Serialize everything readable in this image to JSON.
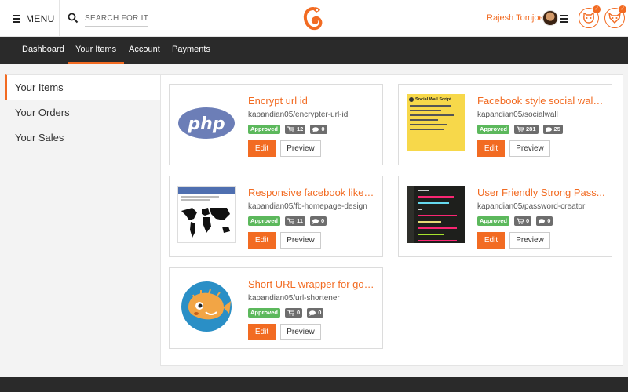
{
  "header": {
    "menu_label": "MENU",
    "search_placeholder": "SEARCH FOR ITEMS",
    "user_name": "Rajesh Tomjoe",
    "brand_color": "#f26b22"
  },
  "nav": {
    "items": [
      {
        "label": "Dashboard"
      },
      {
        "label": "Your Items"
      },
      {
        "label": "Account"
      },
      {
        "label": "Payments"
      }
    ],
    "active": "Your Items"
  },
  "sidebar": {
    "items": [
      {
        "label": "Your Items"
      },
      {
        "label": "Your Orders"
      },
      {
        "label": "Your Sales"
      }
    ],
    "active": "Your Items"
  },
  "items": [
    {
      "title": "Encrypt url id",
      "slug": "kapandian05/encrypter-url-id",
      "status": "Approved",
      "carts": "12",
      "comments": "0",
      "thumb_icon": "php-logo",
      "edit_label": "Edit",
      "preview_label": "Preview"
    },
    {
      "title": "Facebook style social wall ...",
      "slug": "kapandian05/socialwall",
      "status": "Approved",
      "carts": "281",
      "comments": "25",
      "thumb_icon": "social-wall-script-cover",
      "thumb_text": "Social Wall Script",
      "edit_label": "Edit",
      "preview_label": "Preview"
    },
    {
      "title": "Responsive facebook like s...",
      "slug": "kapandian05/fb-homepage-design",
      "status": "Approved",
      "carts": "11",
      "comments": "0",
      "thumb_icon": "world-map-screenshot",
      "edit_label": "Edit",
      "preview_label": "Preview"
    },
    {
      "title": "User Friendly Strong Pass...",
      "slug": "kapandian05/password-creator",
      "status": "Approved",
      "carts": "0",
      "comments": "0",
      "thumb_icon": "code-editor-screenshot",
      "edit_label": "Edit",
      "preview_label": "Preview"
    },
    {
      "title": "Short URL wrapper for goo...",
      "slug": "kapandian05/url-shortener",
      "status": "Approved",
      "carts": "0",
      "comments": "0",
      "thumb_icon": "pufferfish-logo",
      "edit_label": "Edit",
      "preview_label": "Preview"
    }
  ]
}
